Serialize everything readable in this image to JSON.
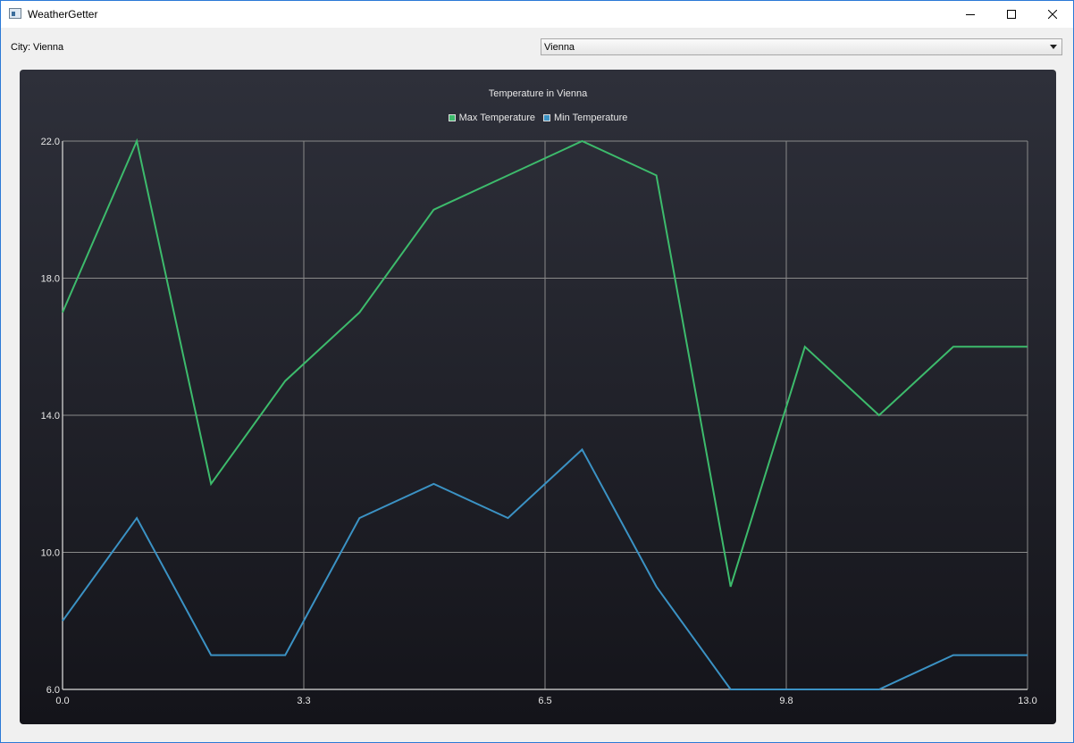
{
  "window": {
    "title": "WeatherGetter",
    "controls": [
      "minimize",
      "maximize",
      "close"
    ]
  },
  "toolbar": {
    "city_label": "City: Vienna",
    "city_selected": "Vienna"
  },
  "colors": {
    "max_series": "#3dbb6c",
    "min_series": "#3b92c4",
    "grid": "#8a8a8a",
    "text": "#e8e8e8"
  },
  "chart_data": {
    "type": "line",
    "title": "Temperature in Vienna",
    "xlabel": "",
    "ylabel": "",
    "xlim": [
      0,
      13
    ],
    "ylim": [
      6,
      22
    ],
    "x_ticks": [
      "0.0",
      "3.3",
      "6.5",
      "9.8",
      "13.0"
    ],
    "y_ticks": [
      "22.0",
      "18.0",
      "14.0",
      "10.0",
      "6.0"
    ],
    "grid": true,
    "legend_position": "top-center",
    "x": [
      0,
      1,
      2,
      3,
      4,
      5,
      6,
      7,
      8,
      9,
      10,
      11,
      12,
      13
    ],
    "series": [
      {
        "name": "Max Temperature",
        "values": [
          17,
          22,
          12,
          15,
          17,
          20,
          21,
          22,
          21,
          9,
          16,
          14,
          16,
          16
        ]
      },
      {
        "name": "Min Temperature",
        "values": [
          8,
          11,
          7,
          7,
          11,
          12,
          11,
          13,
          9,
          6,
          6,
          6,
          7,
          7
        ]
      }
    ]
  }
}
